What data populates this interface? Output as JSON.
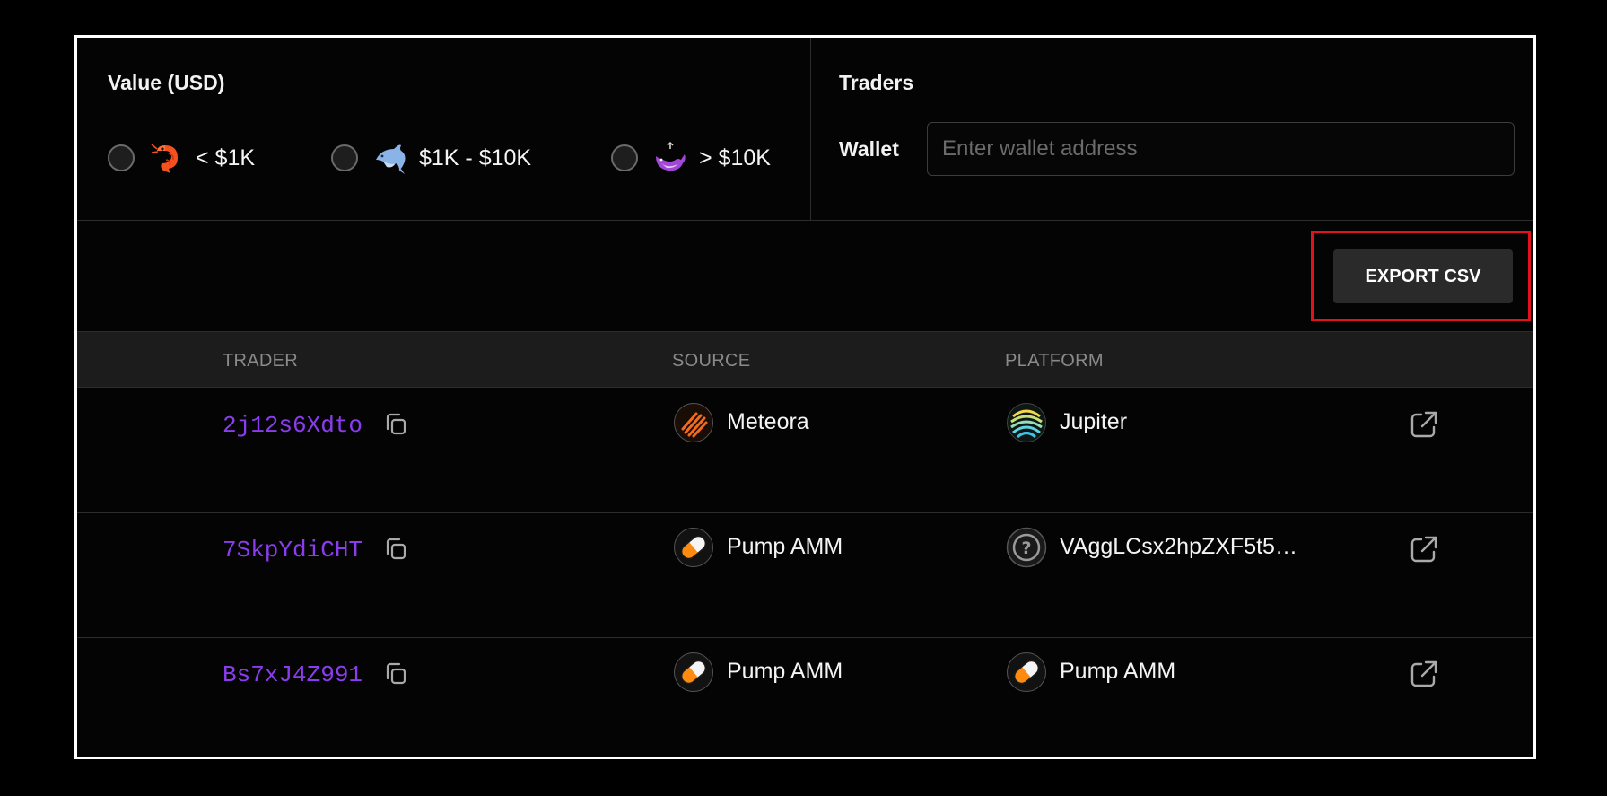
{
  "filters": {
    "value_title": "Value (USD)",
    "value_options": [
      {
        "label": "< $1K",
        "icon": "shrimp-icon"
      },
      {
        "label": "$1K - $10K",
        "icon": "dolphin-icon"
      },
      {
        "label": "> $10K",
        "icon": "whale-icon"
      }
    ],
    "traders_title": "Traders",
    "wallet_label": "Wallet",
    "wallet_placeholder": "Enter wallet address",
    "wallet_value": ""
  },
  "toolbar": {
    "export_label": "EXPORT CSV",
    "highlight_color": "#e0121b"
  },
  "table": {
    "headers": {
      "trader": "TRADER",
      "source": "SOURCE",
      "platform": "PLATFORM"
    },
    "rows": [
      {
        "trader": "2j12s6Xdto",
        "source": "Meteora",
        "source_icon": "meteora-icon",
        "platform": "Jupiter",
        "platform_icon": "jupiter-icon"
      },
      {
        "trader": "7SkpYdiCHT",
        "source": "Pump AMM",
        "source_icon": "pill-icon",
        "platform": "VAggLCsx2hpZXF5t5…",
        "platform_icon": "unknown-icon"
      },
      {
        "trader": "Bs7xJ4Z991",
        "source": "Pump AMM",
        "source_icon": "pill-icon",
        "platform": "Pump AMM",
        "platform_icon": "pill-icon"
      }
    ]
  },
  "colors": {
    "trader_address": "#8b3cf0",
    "background": "#000000",
    "header_bg": "#1c1c1c",
    "button_bg": "#2a2a2a"
  }
}
